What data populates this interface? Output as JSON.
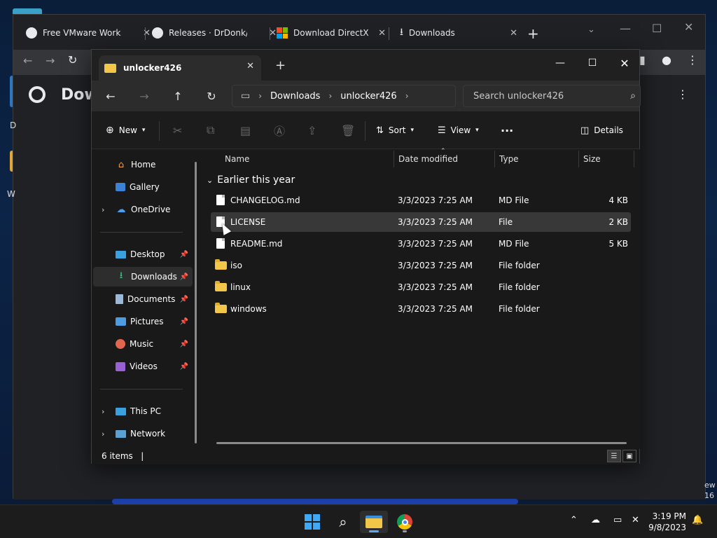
{
  "chrome": {
    "tabs": [
      {
        "title": "Free VMware Workstation",
        "icon": "github-icon"
      },
      {
        "title": "Releases · DrDonk/unlocker",
        "icon": "github-icon"
      },
      {
        "title": "Download DirectX End-User Runtime",
        "icon": "microsoft-icon"
      },
      {
        "title": "Downloads",
        "icon": "download-icon"
      }
    ],
    "page_heading": "Dow",
    "bg_text_d": "D",
    "bg_text_w": "W",
    "bg_text_ew": "ew",
    "bg_text_16": "16"
  },
  "explorer": {
    "tab_title": "unlocker426",
    "breadcrumb": [
      "Downloads",
      "unlocker426"
    ],
    "search_placeholder": "Search unlocker426",
    "commands": {
      "new": "New",
      "sort": "Sort",
      "view": "View",
      "details": "Details"
    },
    "sidebar": {
      "top": [
        {
          "label": "Home",
          "icon": "home-icon"
        },
        {
          "label": "Gallery",
          "icon": "gallery-icon"
        },
        {
          "label": "OneDrive",
          "icon": "onedrive-icon"
        }
      ],
      "quick": [
        {
          "label": "Desktop",
          "icon": "desktop-icon"
        },
        {
          "label": "Downloads",
          "icon": "downloads-icon"
        },
        {
          "label": "Documents",
          "icon": "documents-icon"
        },
        {
          "label": "Pictures",
          "icon": "pictures-icon"
        },
        {
          "label": "Music",
          "icon": "music-icon"
        },
        {
          "label": "Videos",
          "icon": "videos-icon"
        }
      ],
      "bottom": [
        {
          "label": "This PC",
          "icon": "this-pc-icon"
        },
        {
          "label": "Network",
          "icon": "network-icon"
        }
      ]
    },
    "columns": [
      "Name",
      "Date modified",
      "Type",
      "Size"
    ],
    "group_label": "Earlier this year",
    "files": [
      {
        "name": "CHANGELOG.md",
        "date": "3/3/2023 7:25 AM",
        "type": "MD File",
        "size": "4 KB",
        "kind": "file"
      },
      {
        "name": "LICENSE",
        "date": "3/3/2023 7:25 AM",
        "type": "File",
        "size": "2 KB",
        "kind": "file"
      },
      {
        "name": "README.md",
        "date": "3/3/2023 7:25 AM",
        "type": "MD File",
        "size": "5 KB",
        "kind": "file"
      },
      {
        "name": "iso",
        "date": "3/3/2023 7:25 AM",
        "type": "File folder",
        "size": "",
        "kind": "folder"
      },
      {
        "name": "linux",
        "date": "3/3/2023 7:25 AM",
        "type": "File folder",
        "size": "",
        "kind": "folder"
      },
      {
        "name": "windows",
        "date": "3/3/2023 7:25 AM",
        "type": "File folder",
        "size": "",
        "kind": "folder"
      }
    ],
    "status_count": "6 items"
  },
  "taskbar": {
    "time": "3:19 PM",
    "date": "9/8/2023"
  },
  "colors": {
    "accent": "#5ca8ff",
    "folder": "#f2c649",
    "selection": "#383838"
  }
}
